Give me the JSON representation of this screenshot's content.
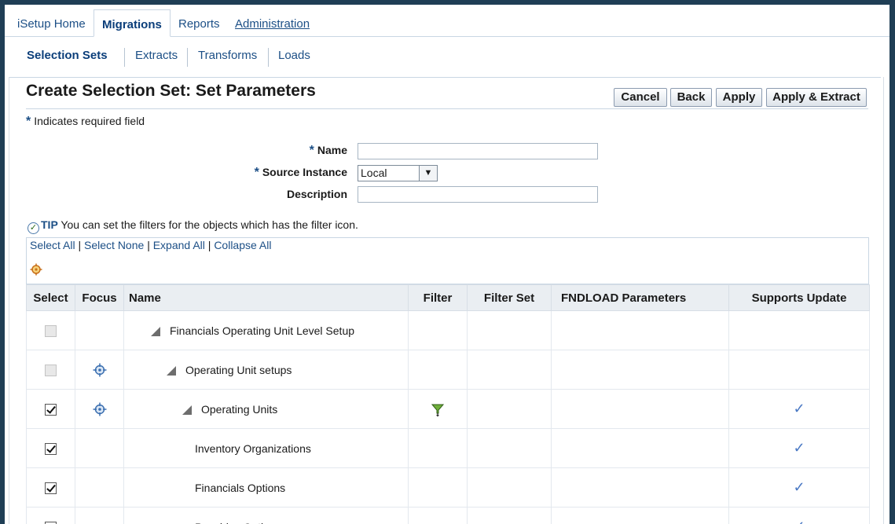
{
  "tabs": {
    "home": "iSetup Home",
    "migrations": "Migrations",
    "reports": "Reports",
    "administration": "Administration"
  },
  "subtabs": {
    "selection_sets": "Selection Sets",
    "extracts": "Extracts",
    "transforms": "Transforms",
    "loads": "Loads"
  },
  "page": {
    "title": "Create Selection Set: Set Parameters",
    "required_star": "*",
    "required_note": "Indicates required field"
  },
  "buttons": {
    "cancel": "Cancel",
    "back": "Back",
    "apply": "Apply",
    "apply_extract": "Apply & Extract"
  },
  "form": {
    "name_label": "Name",
    "name_value": "",
    "source_label": "Source Instance",
    "source_value": "Local",
    "description_label": "Description",
    "description_value": ""
  },
  "tip": {
    "label": "TIP",
    "text": "You can set the filters for the objects which has the filter icon."
  },
  "controls": {
    "select_all": "Select All",
    "select_none": "Select None",
    "expand_all": "Expand All",
    "collapse_all": "Collapse All",
    "separator": "|"
  },
  "table": {
    "columns": [
      "Select",
      "Focus",
      "Name",
      "Filter",
      "Filter Set",
      "FNDLOAD Parameters",
      "Supports Update"
    ],
    "rows": [
      {
        "name": "Financials Operating Unit Level Setup",
        "select": "disabled",
        "focus": false,
        "expand": true,
        "filter": false,
        "supports_update": false
      },
      {
        "name": "Operating Unit setups",
        "select": "disabled",
        "focus": true,
        "expand": true,
        "filter": false,
        "supports_update": false
      },
      {
        "name": "Operating Units",
        "select": "checked",
        "focus": true,
        "expand": true,
        "filter": true,
        "supports_update": true
      },
      {
        "name": "Inventory Organizations",
        "select": "checked",
        "focus": false,
        "expand": false,
        "filter": false,
        "supports_update": true
      },
      {
        "name": "Financials Options",
        "select": "checked",
        "focus": false,
        "expand": false,
        "filter": false,
        "supports_update": true
      },
      {
        "name": "Payables Options",
        "select": "checked",
        "focus": false,
        "expand": false,
        "filter": false,
        "supports_update": true
      }
    ],
    "update_mark": "✓",
    "expand_icon": "collapse-triangle-icon",
    "focus_icon": "crosshair-icon",
    "filter_icon": "funnel-icon"
  }
}
